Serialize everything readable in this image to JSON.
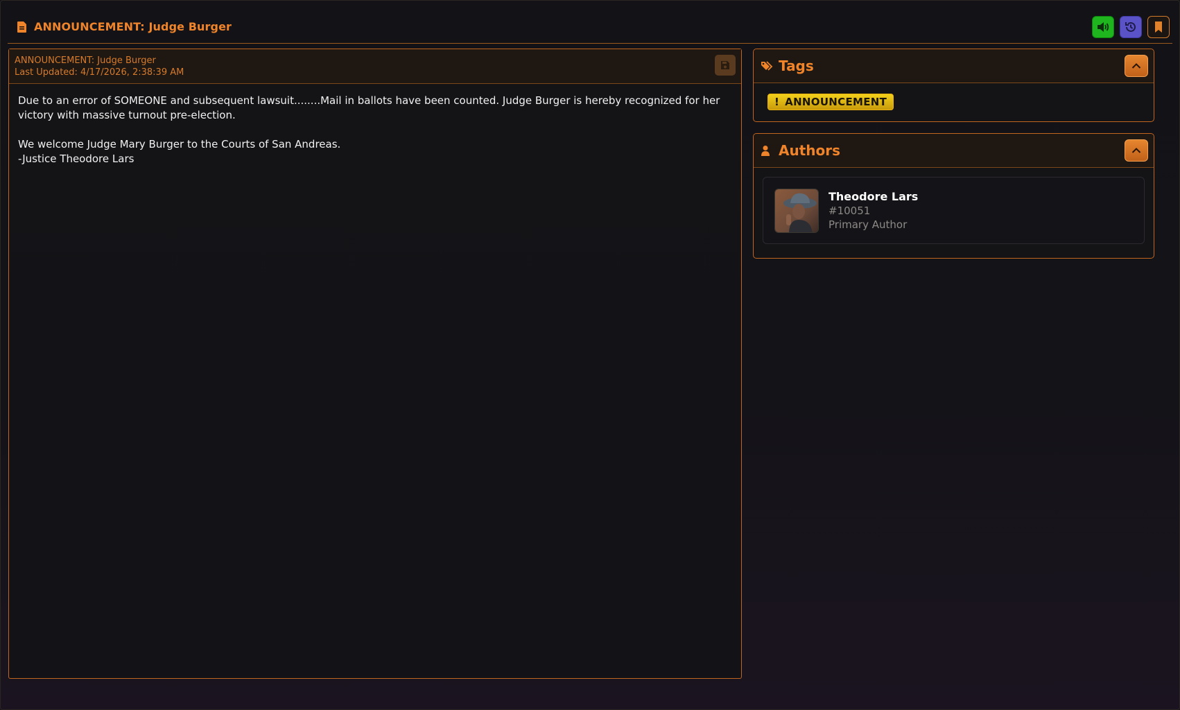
{
  "header": {
    "title": "ANNOUNCEMENT: Judge Burger",
    "actions": [
      {
        "name": "sound-toggle",
        "icon": "speaker-icon",
        "color": "#1fb51f"
      },
      {
        "name": "history",
        "icon": "history-icon",
        "color": "#5a53c8"
      },
      {
        "name": "bookmark",
        "icon": "bookmark-icon",
        "color": "#d07a2a"
      }
    ]
  },
  "document": {
    "title": "ANNOUNCEMENT: Judge Burger",
    "last_updated": "Last Updated: 4/17/2026, 2:38:39 AM",
    "body": {
      "line1": "Due to an error of SOMEONE and subsequent lawsuit........Mail in ballots have been counted. Judge Burger is hereby recognized for her victory with massive turnout pre-election.",
      "line2": "We welcome Judge Mary Burger to the Courts of San Andreas.",
      "line3": "-Justice Theodore Lars"
    },
    "save_icon": "save-icon"
  },
  "tags": {
    "title": "Tags",
    "icon": "tags-icon",
    "items": [
      {
        "label": "ANNOUNCEMENT",
        "prefix": "!",
        "color": "#f3d01a"
      }
    ]
  },
  "authors": {
    "title": "Authors",
    "icon": "user-icon",
    "items": [
      {
        "name": "Theodore Lars",
        "id": "#10051",
        "role": "Primary Author",
        "avatar": "avatar-image"
      }
    ]
  },
  "colors": {
    "accent": "#f0842a",
    "border": "#c2651e",
    "background": "#131317"
  }
}
